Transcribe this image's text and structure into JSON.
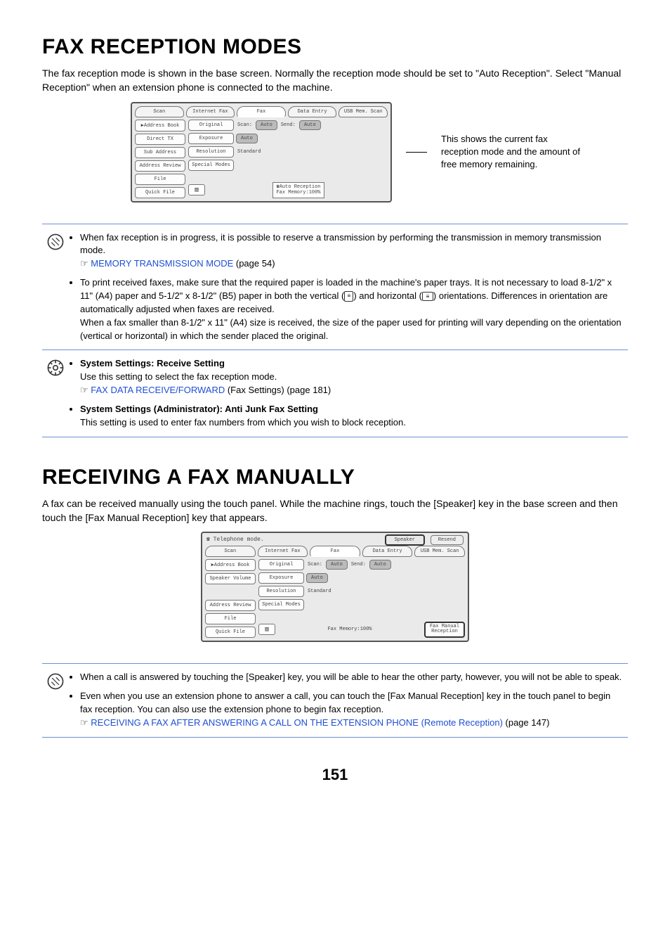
{
  "h1a": "FAX RECEPTION MODES",
  "p1": "The fax reception mode is shown in the base screen. Normally the reception mode should be set to \"Auto Reception\". Select \"Manual Reception\" when an extension phone is connected to the machine.",
  "screen1": {
    "tabs": [
      "Scan",
      "Internet Fax",
      "Fax",
      "Data Entry",
      "USB Mem. Scan"
    ],
    "left": [
      "Address Book",
      "Direct TX",
      "Sub Address",
      "Address Review",
      "File",
      "Quick File"
    ],
    "r1": {
      "original": "Original",
      "scan": "Scan:",
      "auto1": "Auto",
      "send": "Send:",
      "auto2": "Auto"
    },
    "r2": {
      "exposure": "Exposure",
      "auto": "Auto"
    },
    "r3": {
      "resolution": "Resolution",
      "standard": "Standard"
    },
    "r4": {
      "special": "Special Modes"
    },
    "status": {
      "line1": "Auto Reception",
      "line2": "Fax Memory:100%"
    }
  },
  "caption1": "This shows the current fax reception mode and the amount of free memory remaining.",
  "note_box": {
    "b1a": "When fax reception is in progress, it is possible to reserve a transmission by performing the transmission in memory transmission mode.",
    "b1link": "MEMORY TRANSMISSION MODE",
    "b1page": " (page 54)",
    "b2a": "To print received faxes, make sure that the required paper is loaded in the machine's paper trays. It is not necessary to load 8-1/2\" x 11\" (A4) paper and 5-1/2\" x 8-1/2\" (B5) paper in both the vertical (",
    "b2b": ") and horizontal (",
    "b2c": ") orientations. Differences in orientation are automatically adjusted when faxes are received.",
    "b2d": "When a fax smaller than 8-1/2\" x 11\" (A4) size is received, the size of the paper used for printing will vary depending on the orientation (vertical or horizontal) in which the sender placed the original."
  },
  "sys_box": {
    "s1title": "System Settings: Receive Setting",
    "s1body": "Use this setting to select the fax reception mode.",
    "s1link": "FAX DATA RECEIVE/FORWARD",
    "s1after": " (Fax Settings) (page 181)",
    "s2title": "System Settings (Administrator): Anti Junk Fax Setting",
    "s2body": "This setting is used to enter fax numbers from which you wish to block reception."
  },
  "h1b": "RECEIVING A FAX MANUALLY",
  "p2": "A fax can be received manually using the touch panel. While the machine rings, touch the [Speaker] key in the base screen and then touch the [Fax Manual Reception] key that appears.",
  "screen2": {
    "topmsg": "Telephone mode.",
    "speaker": "Speaker",
    "resend": "Resend",
    "tabs": [
      "Scan",
      "Internet Fax",
      "Fax",
      "Data Entry",
      "USB Mem. Scan"
    ],
    "left": [
      "Address Book",
      "Speaker Volume",
      "",
      "Address Review",
      "File",
      "Quick File"
    ],
    "r1": {
      "original": "Original",
      "scan": "Scan:",
      "auto1": "Auto",
      "send": "Send:",
      "auto2": "Auto"
    },
    "r2": {
      "exposure": "Exposure",
      "auto": "Auto"
    },
    "r3": {
      "resolution": "Resolution",
      "standard": "Standard"
    },
    "r4": {
      "special": "Special Modes"
    },
    "mem": "Fax Memory:100%",
    "manual": "Fax Manual\nReception"
  },
  "note_box2": {
    "b1": "When a call is answered by touching the [Speaker] key, you will be able to hear the other party, however, you will not be able to speak.",
    "b2a": "Even when you use an extension phone to answer a call, you can touch the [Fax Manual Reception] key in the touch panel to begin fax reception. You can also use the extension phone to begin fax reception.",
    "b2link": "RECEIVING A FAX AFTER ANSWERING A CALL ON THE EXTENSION PHONE (Remote Reception)",
    "b2page": " (page 147)"
  },
  "pagenum": "151"
}
